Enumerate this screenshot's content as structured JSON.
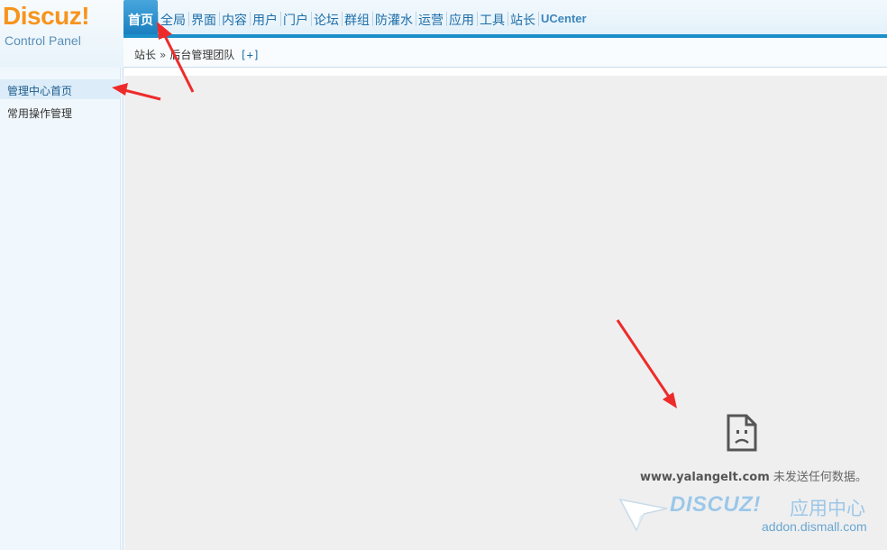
{
  "logo": {
    "title": "Discuz",
    "bang": "!",
    "subtitle": "Control Panel"
  },
  "nav": {
    "items": [
      "首页",
      "全局",
      "界面",
      "内容",
      "用户",
      "门户",
      "论坛",
      "群组",
      "防灌水",
      "运营",
      "应用",
      "工具",
      "站长"
    ],
    "ucenter": "UCenter"
  },
  "breadcrumb": {
    "parent": "站长",
    "separator": "»",
    "current": "后台管理团队",
    "add": "[+]"
  },
  "sidebar": {
    "items": [
      "管理中心首页",
      "常用操作管理"
    ]
  },
  "main": {
    "error_host": "www.yalangelt.com",
    "error_text": " 未发送任何数据。",
    "icon": "sad-document-icon"
  },
  "watermark": {
    "brand": "DISCUZ!",
    "cn": "应用中心",
    "url": "addon.dismall.com"
  },
  "colors": {
    "nav_active": "#1a7fbf",
    "nav_bar": "#1a8fc9",
    "logo": "#f7941d",
    "annotation": "#ee2b2b"
  }
}
